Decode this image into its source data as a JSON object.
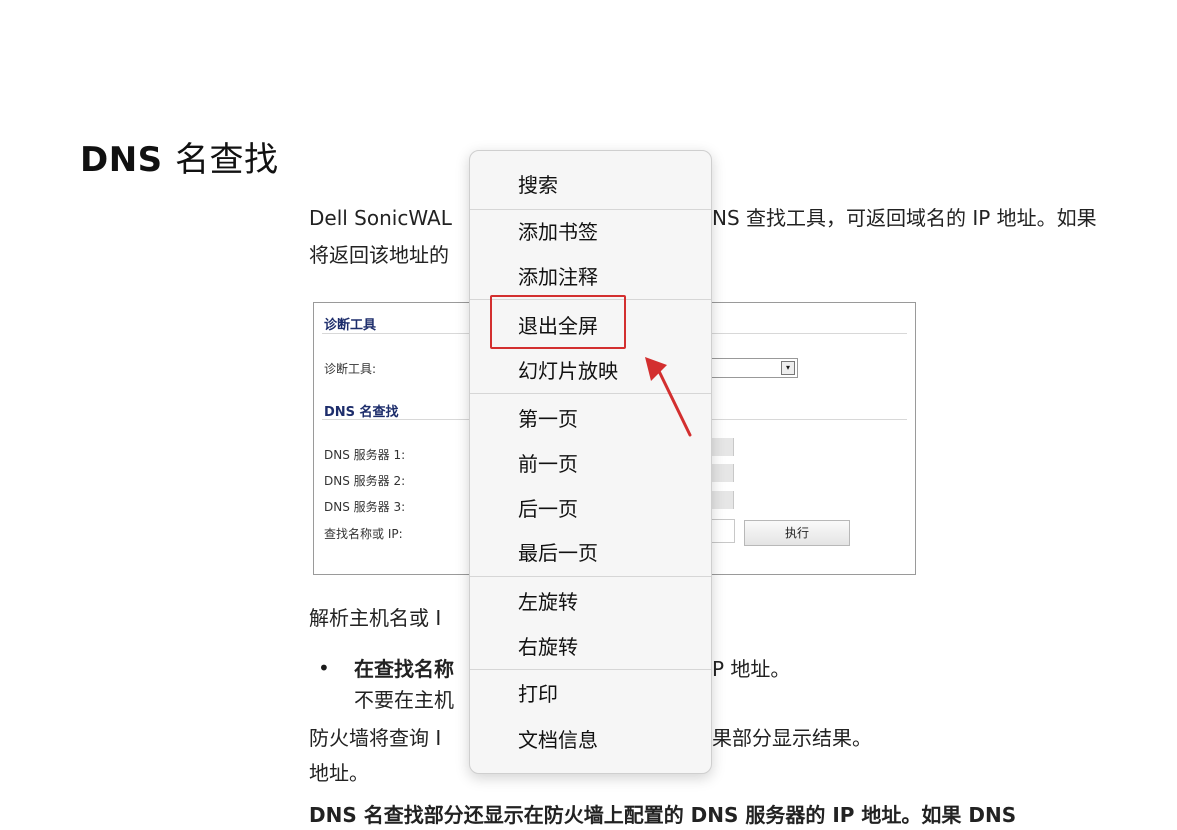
{
  "document": {
    "title_latin": "DNS",
    "title_cjk": "名查找",
    "para1_line1": "Dell SonicWAL",
    "para1_right": "NS 查找工具，可返回域名的 IP 地址。如果",
    "para1_line2": "将返回该地址的",
    "para2": "解析主机名或 I",
    "bullet_line1": "在查找名称",
    "bullet_right": "P 地址。",
    "bullet_line2": "不要在主机",
    "para3_line1": "防火墙将查询 I",
    "para3_right": "果部分显示结果。",
    "para3_line2": "地址。",
    "para4": "DNS 名查找部分还显示在防火墙上配置的 DNS 服务器的 IP 地址。如果 DNS"
  },
  "screenshot": {
    "section1": "诊断工具",
    "tool_label": "诊断工具:",
    "section2": "DNS 名查找",
    "dns1": "DNS 服务器 1:",
    "dns2": "DNS 服务器 2:",
    "dns3": "DNS 服务器 3:",
    "lookup_label": "查找名称或 IP:",
    "exec_button": "执行",
    "select_arrow": "▾"
  },
  "context_menu": {
    "items": [
      {
        "label": "搜索"
      },
      {
        "label": "添加书签"
      },
      {
        "label": "添加注释"
      },
      {
        "label": "退出全屏"
      },
      {
        "label": "幻灯片放映"
      },
      {
        "label": "第一页"
      },
      {
        "label": "前一页"
      },
      {
        "label": "后一页"
      },
      {
        "label": "最后一页"
      },
      {
        "label": "左旋转"
      },
      {
        "label": "右旋转"
      },
      {
        "label": "打印"
      },
      {
        "label": "文档信息"
      }
    ],
    "highlighted_item": "退出全屏"
  },
  "colors": {
    "annotation_red": "#d32f2f",
    "menu_bg": "#f6f6f6",
    "section_header": "#1d2d6b"
  }
}
